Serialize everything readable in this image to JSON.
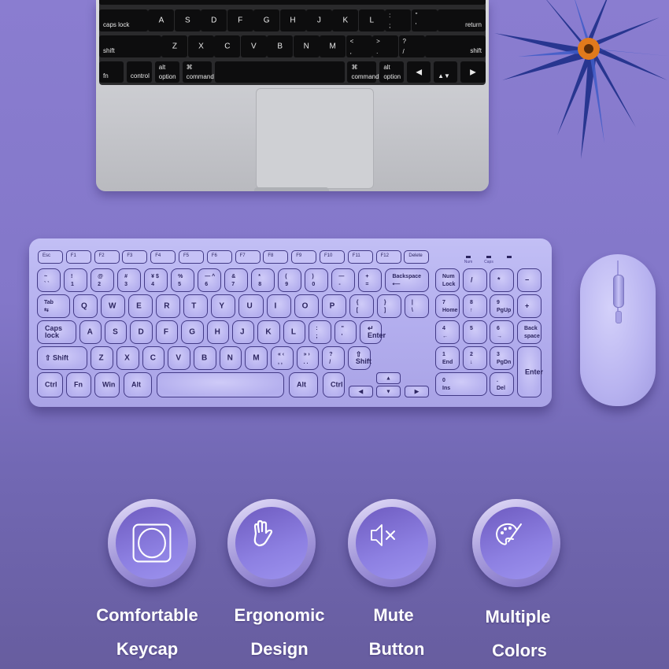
{
  "laptop": {
    "rows": [
      [
        "caps lock",
        "A",
        "S",
        "D",
        "F",
        "G",
        "H",
        "J",
        "K",
        "L",
        [
          ":",
          ";"
        ],
        [
          "\"",
          "'"
        ],
        "return"
      ],
      [
        "shift",
        "Z",
        "X",
        "C",
        "V",
        "B",
        "N",
        "M",
        [
          "<",
          ","
        ],
        [
          ">",
          "."
        ],
        [
          "?",
          "/"
        ],
        "shift"
      ],
      [
        "fn",
        "control",
        [
          "alt",
          "option"
        ],
        [
          "⌘",
          "command"
        ],
        "",
        [
          "⌘",
          "command"
        ],
        [
          "alt",
          "option"
        ],
        "◀",
        "▲▼",
        "▶"
      ]
    ]
  },
  "keyboard": {
    "fn_row": [
      "Esc",
      "F1",
      "F2",
      "F3",
      "F4",
      "F5",
      "F6",
      "F7",
      "F8",
      "F9",
      "F10",
      "F11",
      "F12",
      "Delete"
    ],
    "indicators": [
      "Num",
      "Caps",
      ""
    ],
    "rows": [
      [
        [
          "~",
          "` `"
        ],
        [
          "!",
          "1"
        ],
        [
          "@",
          "2"
        ],
        [
          "#",
          "3"
        ],
        [
          "¥ $",
          "4"
        ],
        [
          "%",
          "5"
        ],
        [
          "— ^",
          "6"
        ],
        [
          "&",
          "7"
        ],
        [
          "*",
          "8"
        ],
        [
          "(",
          "9"
        ],
        [
          ")",
          "0"
        ],
        [
          "—",
          "-"
        ],
        [
          "+",
          "="
        ],
        [
          "Backspace",
          "⟵"
        ]
      ],
      [
        [
          "Tab",
          "⇆"
        ],
        "Q",
        "W",
        "E",
        "R",
        "T",
        "Y",
        "U",
        "I",
        "O",
        "P",
        [
          "{",
          "["
        ],
        [
          "}",
          "]"
        ],
        [
          "|",
          "\\"
        ]
      ],
      [
        "Caps lock",
        "A",
        "S",
        "D",
        "F",
        "G",
        "H",
        "J",
        "K",
        "L",
        [
          ":",
          ";"
        ],
        [
          "\"",
          "'"
        ],
        "↵ Enter"
      ],
      [
        "⇧ Shift",
        "Z",
        "X",
        "C",
        "V",
        "B",
        "N",
        "M",
        [
          "« ‹",
          ", ,"
        ],
        [
          "» ›",
          ". ."
        ],
        [
          "?",
          "/"
        ],
        "⇧ Shift"
      ],
      [
        "Ctrl",
        "Fn",
        "Win",
        "Alt",
        "",
        "Alt",
        "Ctrl",
        "◀",
        "▲",
        "▼",
        "▶"
      ]
    ],
    "numpad": [
      [
        [
          "Num",
          "Lock"
        ],
        "/",
        "*",
        "−"
      ],
      [
        [
          "7",
          "Home"
        ],
        [
          "8",
          "↑"
        ],
        [
          "9",
          "PgUp"
        ],
        "+"
      ],
      [
        [
          "4",
          "←"
        ],
        [
          "5",
          ""
        ],
        [
          "6",
          "→"
        ],
        [
          "Back",
          "space"
        ]
      ],
      [
        [
          "1",
          "End"
        ],
        [
          "2",
          "↓"
        ],
        [
          "3",
          "PgDn"
        ],
        "Enter"
      ],
      [
        [
          "0",
          "Ins"
        ],
        [
          ".",
          "Del"
        ]
      ]
    ]
  },
  "features": [
    {
      "icon": "keycap-icon",
      "line1": "Comfortable",
      "line2": "Keycap"
    },
    {
      "icon": "hand-icon",
      "line1": "Ergonomic",
      "line2": "Design"
    },
    {
      "icon": "mute-icon",
      "line1": "Mute",
      "line2": "Button"
    },
    {
      "icon": "palette-icon",
      "line1": "Multiple",
      "line2": "Colors"
    }
  ],
  "colors": {
    "background": "#8377c9",
    "keyboard": "#b3aeee",
    "feature_circle": "#8d80e2",
    "label": "#ffffff"
  }
}
